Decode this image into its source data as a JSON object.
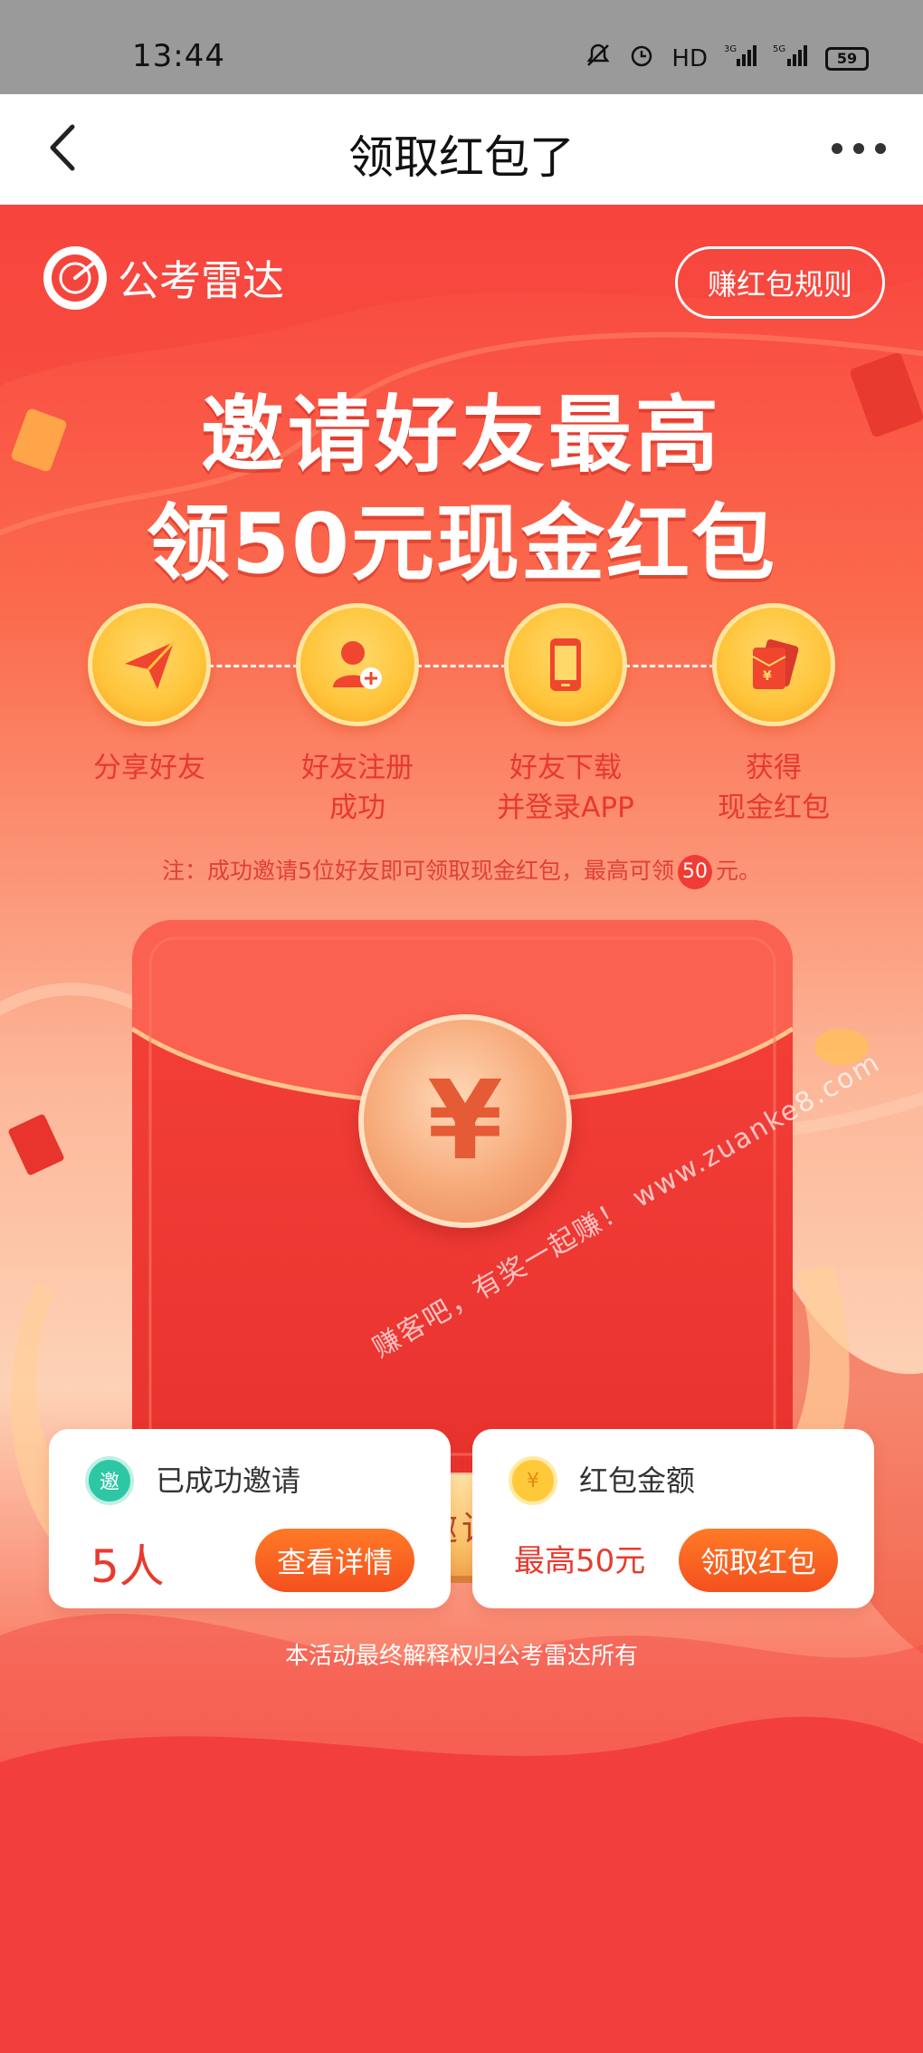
{
  "status": {
    "time": "13:44",
    "indicators": [
      "HD",
      "3G",
      "5G"
    ],
    "battery": "59"
  },
  "nav": {
    "title": "领取红包了",
    "back_icon": "chevron-left-icon",
    "more_icon": "more-dots-icon"
  },
  "brand": {
    "name": "公考雷达",
    "rules_button": "赚红包规则"
  },
  "headline": {
    "line1": "邀请好友最高",
    "line2": "领50元现金红包"
  },
  "steps": [
    {
      "label_line1": "分享好友",
      "label_line2": "",
      "icon": "paper-plane-icon"
    },
    {
      "label_line1": "好友注册",
      "label_line2": "成功",
      "icon": "user-add-icon"
    },
    {
      "label_line1": "好友下载",
      "label_line2": "并登录APP",
      "icon": "phone-icon"
    },
    {
      "label_line1": "获得",
      "label_line2": "现金红包",
      "icon": "red-envelope-icon"
    }
  ],
  "note": {
    "prefix": "注：成功邀请5位好友即可领取现金红包，最高可领",
    "amount": "50",
    "suffix": "元。"
  },
  "envelope": {
    "coin_symbol": "¥",
    "invite_button": "立即邀请好友"
  },
  "watermark": "赚客吧，有奖一起赚！ www.zuanke8.com",
  "cards": {
    "invited": {
      "icon_text": "邀",
      "title": "已成功邀请",
      "value": "5人",
      "button": "查看详情"
    },
    "amount": {
      "icon_text": "¥",
      "title": "红包金额",
      "value": "最高50元",
      "button": "领取红包"
    }
  },
  "footer": "本活动最终解释权归公考雷达所有",
  "colors": {
    "primary_red": "#f23f3d",
    "gold": "#ffc43a",
    "button_orange": "#f4501e"
  }
}
